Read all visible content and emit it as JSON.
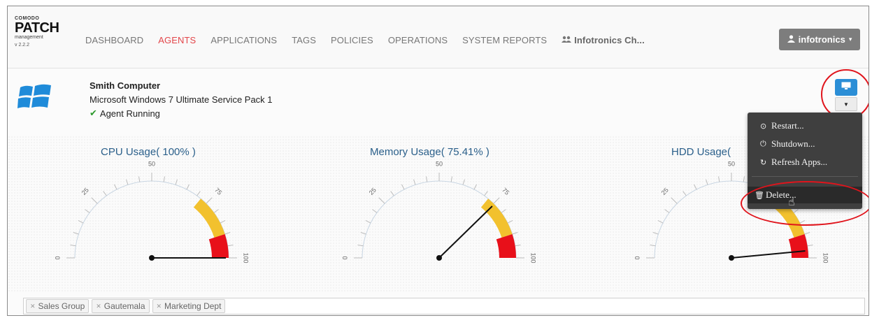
{
  "logo": {
    "line1": "COMODO",
    "line2": "PATCH",
    "line3": "management",
    "version": "v 2.2.2"
  },
  "nav": {
    "items": [
      "DASHBOARD",
      "AGENTS",
      "APPLICATIONS",
      "TAGS",
      "POLICIES",
      "OPERATIONS",
      "SYSTEM REPORTS"
    ],
    "active": "AGENTS",
    "group_label": "Infotronics Ch...",
    "user_label": "infotronics"
  },
  "agent": {
    "name": "Smith Computer",
    "os": "Microsoft Windows 7 Ultimate Service Pack 1",
    "status": "Agent Running"
  },
  "gauges": [
    {
      "title": "CPU Usage( 100% )",
      "value": 100
    },
    {
      "title": "Memory Usage( 75.41% )",
      "value": 75.41
    },
    {
      "title": "HDD Usage(",
      "value": 97
    }
  ],
  "gauge_ticks": [
    "0",
    "25",
    "50",
    "75",
    "100"
  ],
  "menu": {
    "restart": "Restart...",
    "shutdown": "Shutdown...",
    "refresh": "Refresh Apps...",
    "delete": "Delete..."
  },
  "tags": [
    "Sales Group",
    "Gautemala",
    "Marketing Dept"
  ],
  "colors": {
    "active_nav": "#e3474b",
    "button_blue": "#2b8ed6",
    "gauge_title": "#2a5f8a",
    "gauge_yellow": "#f2c12e",
    "gauge_red": "#e8101a",
    "annotation_red": "#e0141c"
  }
}
